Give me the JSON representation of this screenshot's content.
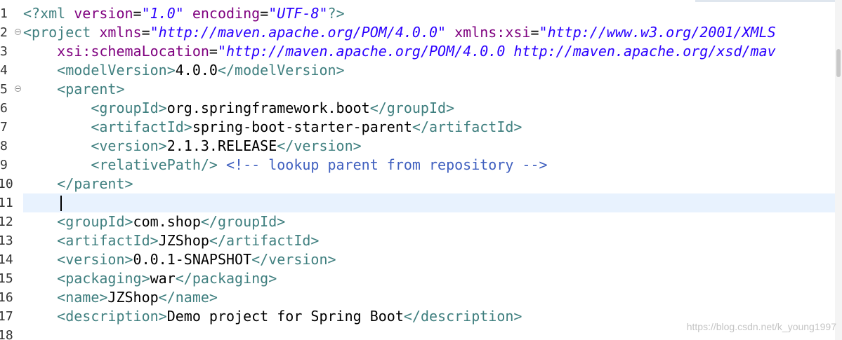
{
  "editor": {
    "line_numbers": [
      "1",
      "2",
      "3",
      "4",
      "5",
      "6",
      "7",
      "8",
      "9",
      "10",
      "11",
      "12",
      "13",
      "14",
      "15",
      "16",
      "17",
      "18"
    ],
    "folded_lines": [
      "2",
      "5"
    ],
    "current_line": "11"
  },
  "code": {
    "l1": {
      "pi_open": "<?xml",
      "a1": " version",
      "eq1": "=",
      "v1": "\"1.0\"",
      "a2": " encoding",
      "eq2": "=",
      "v2": "\"UTF-8\"",
      "pi_close": "?>"
    },
    "l2": {
      "open": "<project",
      "a1": " xmlns",
      "eq1": "=",
      "v1": "\"http://maven.apache.org/POM/4.0.0\"",
      "a2": " xmlns:xsi",
      "eq2": "=",
      "v2": "\"http://www.w3.org/2001/XMLS"
    },
    "l3": {
      "indent": "    ",
      "a1": "xsi:schemaLocation",
      "eq1": "=",
      "v1": "\"http://maven.apache.org/POM/4.0.0 http://maven.apache.org/xsd/mav"
    },
    "l4": {
      "indent": "    ",
      "open": "<modelVersion>",
      "text": "4.0.0",
      "close": "</modelVersion>"
    },
    "l5": {
      "indent": "    ",
      "open": "<parent>"
    },
    "l6": {
      "indent": "        ",
      "open": "<groupId>",
      "text": "org.springframework.boot",
      "close": "</groupId>"
    },
    "l7": {
      "indent": "        ",
      "open": "<artifactId>",
      "text": "spring-boot-starter-parent",
      "close": "</artifactId>"
    },
    "l8": {
      "indent": "        ",
      "open": "<version>",
      "text": "2.1.3.RELEASE",
      "close": "</version>"
    },
    "l9": {
      "indent": "        ",
      "open": "<relativePath/>",
      "space": " ",
      "comment": "<!-- lookup parent from repository -->"
    },
    "l10": {
      "indent": "    ",
      "close": "</parent>"
    },
    "l12": {
      "indent": "    ",
      "open": "<groupId>",
      "text": "com.shop",
      "close": "</groupId>"
    },
    "l13": {
      "indent": "    ",
      "open": "<artifactId>",
      "text": "JZShop",
      "close": "</artifactId>"
    },
    "l14": {
      "indent": "    ",
      "open": "<version>",
      "text": "0.0.1-SNAPSHOT",
      "close": "</version>"
    },
    "l15": {
      "indent": "    ",
      "open": "<packaging>",
      "text": "war",
      "close": "</packaging>"
    },
    "l16": {
      "indent": "    ",
      "open": "<name>",
      "text": "JZShop",
      "close": "</name>"
    },
    "l17": {
      "indent": "    ",
      "open": "<description>",
      "text": "Demo project for Spring Boot",
      "close": "</description>"
    }
  },
  "watermark": "https://blog.csdn.net/k_young1997",
  "colors": {
    "tag": "#3f7f7f",
    "attribute": "#7f007f",
    "string": "#2a00ff",
    "comment": "#3f5fbf",
    "current_line": "#e8f2fe"
  }
}
